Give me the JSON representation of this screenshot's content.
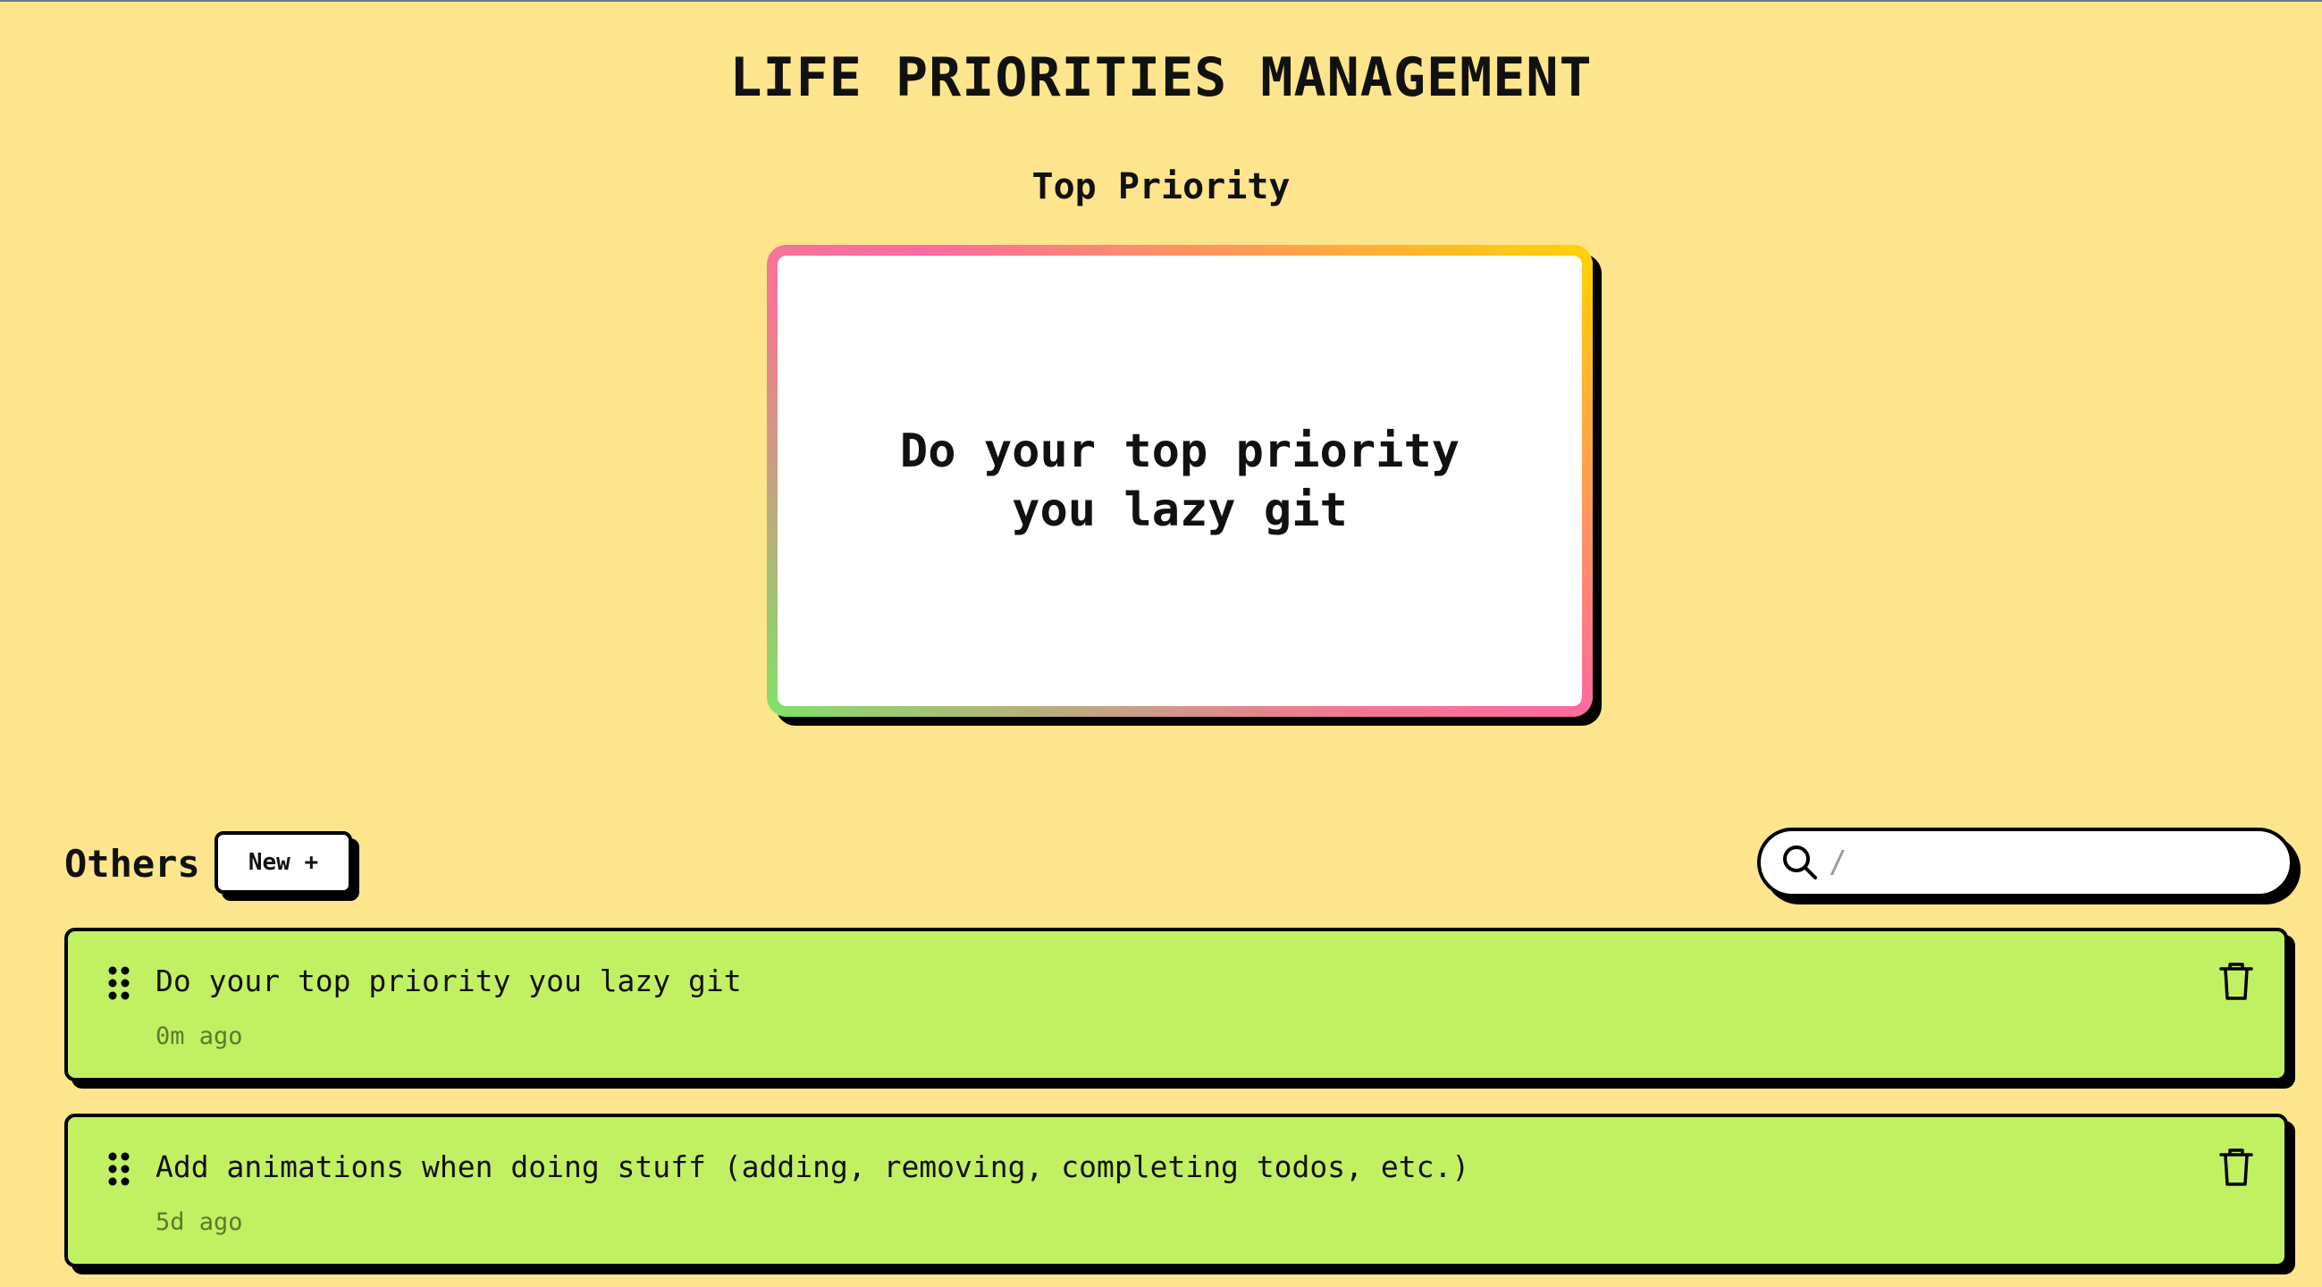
{
  "app": {
    "title": "LIFE PRIORITIES MANAGEMENT"
  },
  "top_priority": {
    "label": "Top Priority",
    "text": "Do your top priority you lazy git"
  },
  "others": {
    "title": "Others",
    "new_button_label": "New +"
  },
  "search": {
    "placeholder": "/",
    "value": "",
    "icon": "search-icon"
  },
  "todos": [
    {
      "text": "Do your top priority you lazy git",
      "time": "0m ago"
    },
    {
      "text": "Add animations when doing stuff (adding, removing, completing todos, etc.)",
      "time": "5d ago"
    }
  ],
  "icons": {
    "drag": "drag-handle-icon",
    "delete": "trash-icon"
  },
  "colors": {
    "background": "#fce58c",
    "todo_background": "#c2f063",
    "card_gradient": [
      "#ffd400",
      "#ff6aa0",
      "#f27a92",
      "#7fe26a"
    ],
    "shadow": "#000000"
  }
}
